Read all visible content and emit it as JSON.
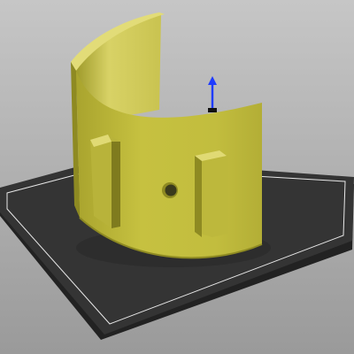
{
  "viewport": {
    "background_top": "#c6c6c6",
    "background_bottom": "#9a9a9a"
  },
  "build_plate": {
    "surface_color": "#343434",
    "edge_color": "#222222",
    "boundary_color": "#e8e8e8"
  },
  "model": {
    "color_front": "#c2bd3e",
    "color_inner": "#dcd66a",
    "color_shadow": "#8e8a22",
    "hole_color": "#3a3a1c"
  },
  "axis_gizmo": {
    "z_axis_color": "#1f3cff",
    "pivot_color": "#111111"
  }
}
